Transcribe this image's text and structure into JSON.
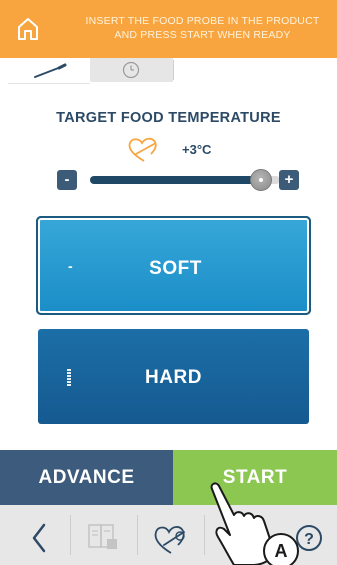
{
  "header": {
    "message": "INSERT THE FOOD PROBE IN THE PRODUCT AND PRESS START WHEN READY",
    "home_icon": "home-icon"
  },
  "tabs": [
    {
      "name": "probe-tab",
      "icon": "probe-icon",
      "active": true
    },
    {
      "name": "timer-tab",
      "icon": "clock-icon",
      "active": false
    }
  ],
  "target": {
    "title": "TARGET  FOOD TEMPERATURE",
    "value": "+3°C",
    "icon": "heart-probe-icon",
    "minus_label": "-",
    "plus_label": "+",
    "slider_level": 0.9
  },
  "presets": [
    {
      "label": "SOFT",
      "mark": "-",
      "selected": true
    },
    {
      "label": "HARD",
      "mark": "bars",
      "selected": false
    }
  ],
  "actions": {
    "advance_label": "ADVANCE",
    "start_label": "START"
  },
  "bottom_bar": {
    "icons": [
      "back-arrow-icon",
      "recipe-book-icon",
      "heart-probe-icon",
      "help-icon"
    ]
  },
  "annotation": {
    "badge": "A"
  },
  "colors": {
    "header": "#f8a53f",
    "navy": "#2c4a66",
    "soft": "#1b8ec8",
    "hard": "#155a90",
    "advance": "#3d5b7c",
    "start": "#8cc751"
  }
}
